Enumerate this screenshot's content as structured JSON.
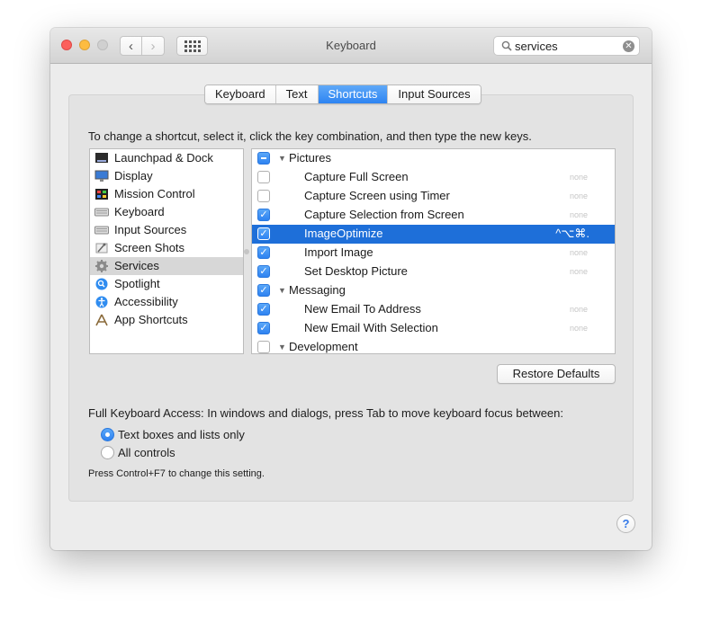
{
  "window": {
    "title": "Keyboard",
    "search_value": "services",
    "clear_glyph": "✕",
    "back_glyph": "‹",
    "forward_glyph": "›"
  },
  "tabs": [
    {
      "label": "Keyboard",
      "active": false
    },
    {
      "label": "Text",
      "active": false
    },
    {
      "label": "Shortcuts",
      "active": true
    },
    {
      "label": "Input Sources",
      "active": false
    }
  ],
  "instruction": "To change a shortcut, select it, click the key combination, and then type the new keys.",
  "categories": [
    {
      "label": "Launchpad & Dock",
      "icon": "dock-icon"
    },
    {
      "label": "Display",
      "icon": "display-icon"
    },
    {
      "label": "Mission Control",
      "icon": "mission-control-icon"
    },
    {
      "label": "Keyboard",
      "icon": "keyboard-icon"
    },
    {
      "label": "Input Sources",
      "icon": "input-sources-icon"
    },
    {
      "label": "Screen Shots",
      "icon": "screenshot-icon"
    },
    {
      "label": "Services",
      "icon": "gear-icon",
      "selected": true
    },
    {
      "label": "Spotlight",
      "icon": "spotlight-icon"
    },
    {
      "label": "Accessibility",
      "icon": "accessibility-icon"
    },
    {
      "label": "App Shortcuts",
      "icon": "app-shortcuts-icon"
    }
  ],
  "services": [
    {
      "type": "group",
      "label": "Pictures",
      "state": "mixed"
    },
    {
      "type": "item",
      "label": "Capture Full Screen",
      "state": "off",
      "shortcut": "none"
    },
    {
      "type": "item",
      "label": "Capture Screen using Timer",
      "state": "off",
      "shortcut": "none"
    },
    {
      "type": "item",
      "label": "Capture Selection from Screen",
      "state": "on",
      "shortcut": "none"
    },
    {
      "type": "item",
      "label": "ImageOptimize",
      "state": "on",
      "shortcut": "^⌥⌘.",
      "selected": true
    },
    {
      "type": "item",
      "label": "Import Image",
      "state": "on",
      "shortcut": "none"
    },
    {
      "type": "item",
      "label": "Set Desktop Picture",
      "state": "on",
      "shortcut": "none"
    },
    {
      "type": "group",
      "label": "Messaging",
      "state": "on"
    },
    {
      "type": "item",
      "label": "New Email To Address",
      "state": "on",
      "shortcut": "none"
    },
    {
      "type": "item",
      "label": "New Email With Selection",
      "state": "on",
      "shortcut": "none"
    },
    {
      "type": "group",
      "label": "Development",
      "state": "off"
    }
  ],
  "restore_defaults": "Restore Defaults",
  "full_keyboard_access": {
    "label": "Full Keyboard Access: In windows and dialogs, press Tab to move keyboard focus between:",
    "options": [
      {
        "label": "Text boxes and lists only",
        "selected": true
      },
      {
        "label": "All controls",
        "selected": false
      }
    ],
    "note": "Press Control+F7 to change this setting."
  },
  "help_glyph": "?",
  "colors": {
    "accent": "#2e82f1",
    "selection": "#1e6fd9"
  }
}
